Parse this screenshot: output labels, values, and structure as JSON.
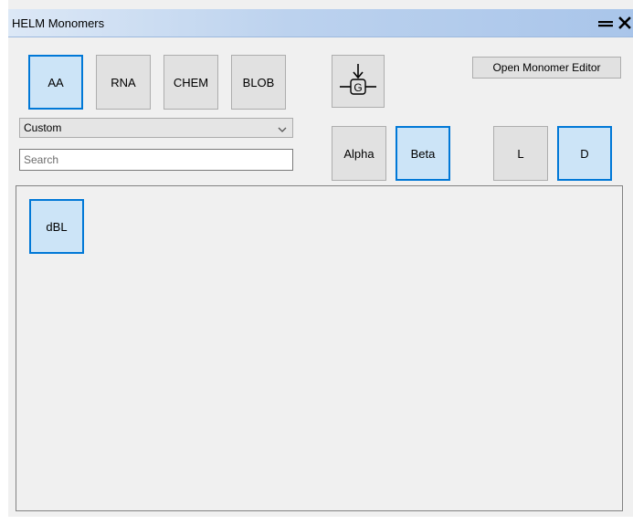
{
  "window": {
    "title": "HELM Monomers"
  },
  "polymer_types": [
    {
      "label": "AA",
      "active": true
    },
    {
      "label": "RNA",
      "active": false
    },
    {
      "label": "CHEM",
      "active": false
    },
    {
      "label": "BLOB",
      "active": false
    }
  ],
  "group_button_icon": "monomer-group-icon",
  "group_button_letter": "G",
  "open_editor_label": "Open Monomer Editor",
  "category_select": {
    "value": "Custom"
  },
  "search": {
    "placeholder": "Search",
    "value": ""
  },
  "backbone": [
    {
      "label": "Alpha",
      "active": false
    },
    {
      "label": "Beta",
      "active": true
    }
  ],
  "stereo": [
    {
      "label": "L",
      "active": false
    },
    {
      "label": "D",
      "active": true
    }
  ],
  "monomers": [
    {
      "label": "dBL",
      "selected": true
    }
  ],
  "colors": {
    "accent": "#0078d7",
    "active_bg": "#cce4f7",
    "title_gradient_end": "#a9c5ea"
  }
}
